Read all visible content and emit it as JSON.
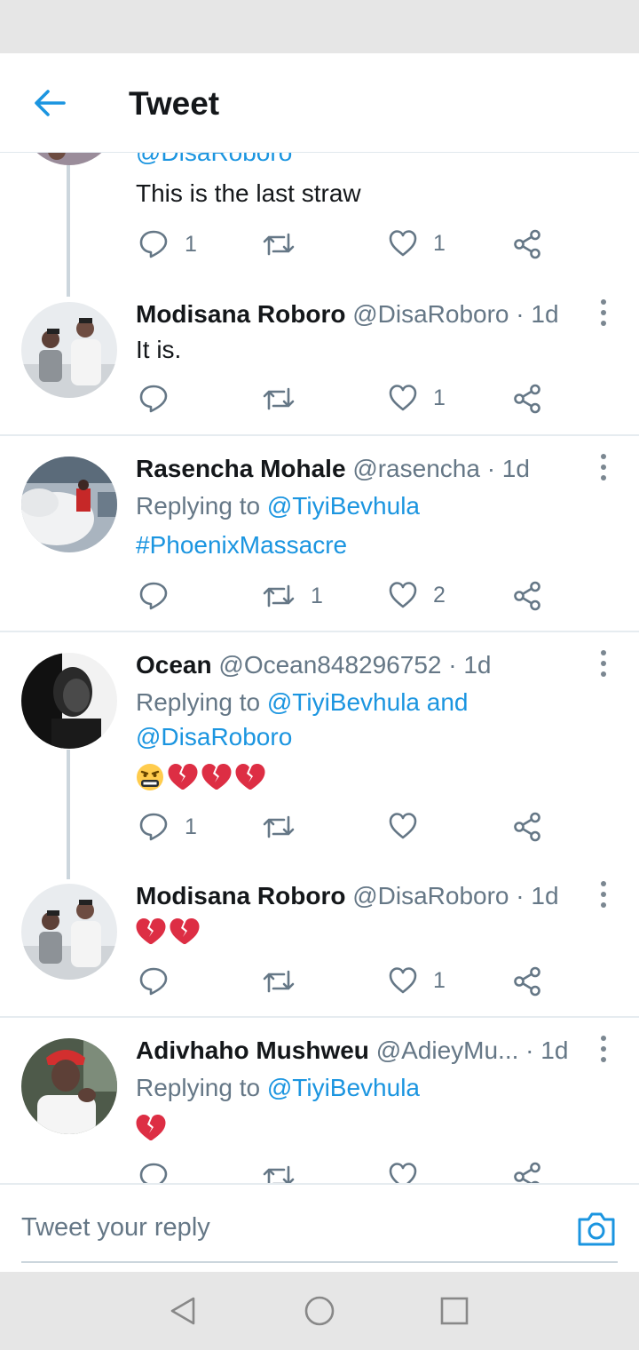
{
  "header": {
    "title": "Tweet"
  },
  "tweets": [
    {
      "handle_partial": "@DisaRoboro",
      "text": "This is the last straw",
      "reply_count": "1",
      "retweet_count": "",
      "like_count": "1"
    },
    {
      "name": "Modisana Roboro",
      "handle": "@DisaRoboro",
      "time": "· 1d",
      "text": "It is.",
      "reply_count": "",
      "retweet_count": "",
      "like_count": "1"
    },
    {
      "name": "Rasencha Mohale",
      "handle": "@rasencha",
      "time": "· 1d",
      "replying_prefix": "Replying to",
      "replying_to": "@TiyiBevhula",
      "text": "#PhoenixMassacre",
      "reply_count": "",
      "retweet_count": "1",
      "like_count": "2"
    },
    {
      "name": "Ocean",
      "handle": "@Ocean848296752",
      "time": "· 1d",
      "replying_prefix": "Replying to",
      "replying_to": "@TiyiBevhula and",
      "replying_to_2": "@DisaRoboro",
      "emojis": [
        "face-with-symbols-on-mouth",
        "broken-heart",
        "broken-heart",
        "broken-heart"
      ],
      "reply_count": "1",
      "retweet_count": "",
      "like_count": ""
    },
    {
      "name": "Modisana Roboro",
      "handle": "@DisaRoboro",
      "time": "· 1d",
      "emojis": [
        "broken-heart",
        "broken-heart"
      ],
      "reply_count": "",
      "retweet_count": "",
      "like_count": "1"
    },
    {
      "name": "Adivhaho Mushweu",
      "handle": "@AdieyMu...",
      "time": "· 1d",
      "replying_prefix": "Replying to",
      "replying_to": "@TiyiBevhula",
      "emojis": [
        "broken-heart"
      ]
    }
  ],
  "reply_bar": {
    "placeholder": "Tweet your reply"
  },
  "colors": {
    "accent": "#1b95e0",
    "text": "#14171a",
    "muted": "#657786",
    "broken_heart": "#dd2e44"
  }
}
